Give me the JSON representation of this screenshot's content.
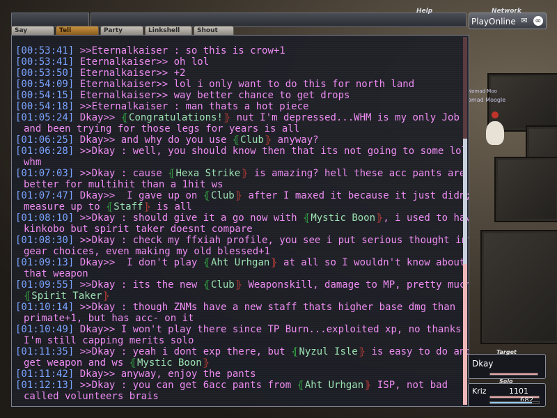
{
  "header": {
    "help_label": "Help",
    "network_label": "Network",
    "playonline_label": "PlayOnline"
  },
  "tabs": [
    {
      "label": "Say",
      "active": false
    },
    {
      "label": "Tell",
      "active": true
    },
    {
      "label": "Party",
      "active": false
    },
    {
      "label": "Linkshell",
      "active": false
    },
    {
      "label": "Shout",
      "active": false
    }
  ],
  "npc": {
    "name_top": "Nomad Moo",
    "name": "omad Moogle"
  },
  "chat": {
    "lines": [
      {
        "ts": "[00:53:41]",
        "parts": [
          {
            "t": " >>Eternalkaiser : so this is crow+1"
          }
        ]
      },
      {
        "ts": "[00:53:41]",
        "parts": [
          {
            "t": " Eternalkaiser>> oh lol"
          }
        ]
      },
      {
        "ts": "[00:53:50]",
        "parts": [
          {
            "t": " Eternalkaiser>> +2"
          }
        ]
      },
      {
        "ts": "[00:54:09]",
        "parts": [
          {
            "t": " Eternalkaiser>> lol i only want to do this for north land"
          }
        ]
      },
      {
        "ts": "[00:54:15]",
        "parts": [
          {
            "t": " Eternalkaiser>> way better chance to get drops"
          }
        ]
      },
      {
        "ts": "[00:54:18]",
        "parts": [
          {
            "t": " >>Eternalkaiser : man thats a hot piece"
          }
        ]
      },
      {
        "ts": "[01:05:24]",
        "parts": [
          {
            "t": " Dkay>> "
          },
          {
            "t": "Congratulations!",
            "at": true
          },
          {
            "t": " nut I'm depressed...WHM is my only Job"
          }
        ]
      },
      {
        "cont": true,
        "parts": [
          {
            "t": "and been trying for those legs for years is all"
          }
        ]
      },
      {
        "ts": "[01:06:25]",
        "parts": [
          {
            "t": " Dkay>> and why do you use "
          },
          {
            "t": "Club",
            "at": true
          },
          {
            "t": " anyway?"
          }
        ]
      },
      {
        "ts": "[01:06:28]",
        "parts": [
          {
            "t": " >>Dkay : well, you should know then that its not going to some lol"
          }
        ]
      },
      {
        "cont": true,
        "parts": [
          {
            "t": "whm"
          }
        ]
      },
      {
        "ts": "[01:07:03]",
        "parts": [
          {
            "t": " >>Dkay : cause "
          },
          {
            "t": "Hexa Strike",
            "at": true
          },
          {
            "t": " is amazing? hell these acc pants are"
          }
        ]
      },
      {
        "cont": true,
        "parts": [
          {
            "t": "better for multihit than a 1hit ws"
          }
        ]
      },
      {
        "ts": "[01:07:47]",
        "parts": [
          {
            "t": " Dkay>>  I gave up on "
          },
          {
            "t": "Club",
            "at": true
          },
          {
            "t": " after I maxed it because it just didn;t"
          }
        ]
      },
      {
        "cont": true,
        "parts": [
          {
            "t": "measure up to "
          },
          {
            "t": "Staff",
            "at": true
          },
          {
            "t": " is all"
          }
        ]
      },
      {
        "ts": "[01:08:10]",
        "parts": [
          {
            "t": " >>Dkay : should give it a go now with "
          },
          {
            "t": "Mystic Boon",
            "at": true
          },
          {
            "t": ", i used to have"
          }
        ]
      },
      {
        "cont": true,
        "parts": [
          {
            "t": "kinkobo but spirit taker doesnt compare"
          }
        ]
      },
      {
        "ts": "[01:08:30]",
        "parts": [
          {
            "t": " >>Dkay : check my ffxiah profile, you see i put serious thought into"
          }
        ]
      },
      {
        "cont": true,
        "parts": [
          {
            "t": "gear choices, even making my old blessed+1"
          }
        ]
      },
      {
        "ts": "[01:09:13]",
        "parts": [
          {
            "t": " Dkay>>  I don't play "
          },
          {
            "t": "Aht Urhgan",
            "at": true
          },
          {
            "t": " at all so I wouldn't know about"
          }
        ]
      },
      {
        "cont": true,
        "parts": [
          {
            "t": "that weapon"
          }
        ]
      },
      {
        "ts": "[01:09:55]",
        "parts": [
          {
            "t": " >>Dkay : its the new "
          },
          {
            "t": "Club",
            "at": true
          },
          {
            "t": " Weaponskill, damage to MP, pretty much"
          }
        ]
      },
      {
        "cont": true,
        "parts": [
          {
            "t": "Spirit Taker",
            "at": true
          }
        ]
      },
      {
        "ts": "[01:10:14]",
        "parts": [
          {
            "t": " >>Dkay : though ZNMs have a new staff thats higher base dmg than"
          }
        ]
      },
      {
        "cont": true,
        "parts": [
          {
            "t": "primate+1, but has acc- on it"
          }
        ]
      },
      {
        "ts": "[01:10:49]",
        "parts": [
          {
            "t": " Dkay>> I won't play there since TP Burn...exploited xp, no thanks..."
          }
        ]
      },
      {
        "cont": true,
        "parts": [
          {
            "t": "I'm still capping merits solo"
          }
        ]
      },
      {
        "ts": "[01:11:35]",
        "parts": [
          {
            "t": " >>Dkay : yeah i dont exp there, but "
          },
          {
            "t": "Nyzul Isle",
            "at": true
          },
          {
            "t": " is easy to do and"
          }
        ]
      },
      {
        "cont": true,
        "parts": [
          {
            "t": "get weapon and ws "
          },
          {
            "t": "Mystic Boon",
            "at": true
          }
        ]
      },
      {
        "ts": "[01:11:42]",
        "parts": [
          {
            "t": " Dkay>> anyway, enjoy the pants"
          }
        ]
      },
      {
        "ts": "[01:12:13]",
        "parts": [
          {
            "t": " >>Dkay : you can get 6acc pants from "
          },
          {
            "t": "Aht Urhgan",
            "at": true
          },
          {
            "t": " ISP, not bad"
          }
        ]
      },
      {
        "cont": true,
        "parts": [
          {
            "t": "called volunteers brais"
          }
        ]
      }
    ],
    "scroll_position": 0.42
  },
  "target": {
    "title": "Target",
    "name": "Dkay",
    "hp_fraction": 1.0
  },
  "party": {
    "title": "Solo",
    "name": "Kriz",
    "hp_value": "1101",
    "mp_value": "682",
    "hp_fraction": 1.0,
    "mp_fraction": 0.85
  },
  "colors": {
    "chat_text": "#ee8cf2",
    "timestamp": "#7aa3ff",
    "autotranslate_open": "#38c94a",
    "autotranslate_close": "#e0443a",
    "hp_bar": "#e8a9a9",
    "mp_bar": "#8fc7ee",
    "target_bar": "#e8a9a9"
  }
}
